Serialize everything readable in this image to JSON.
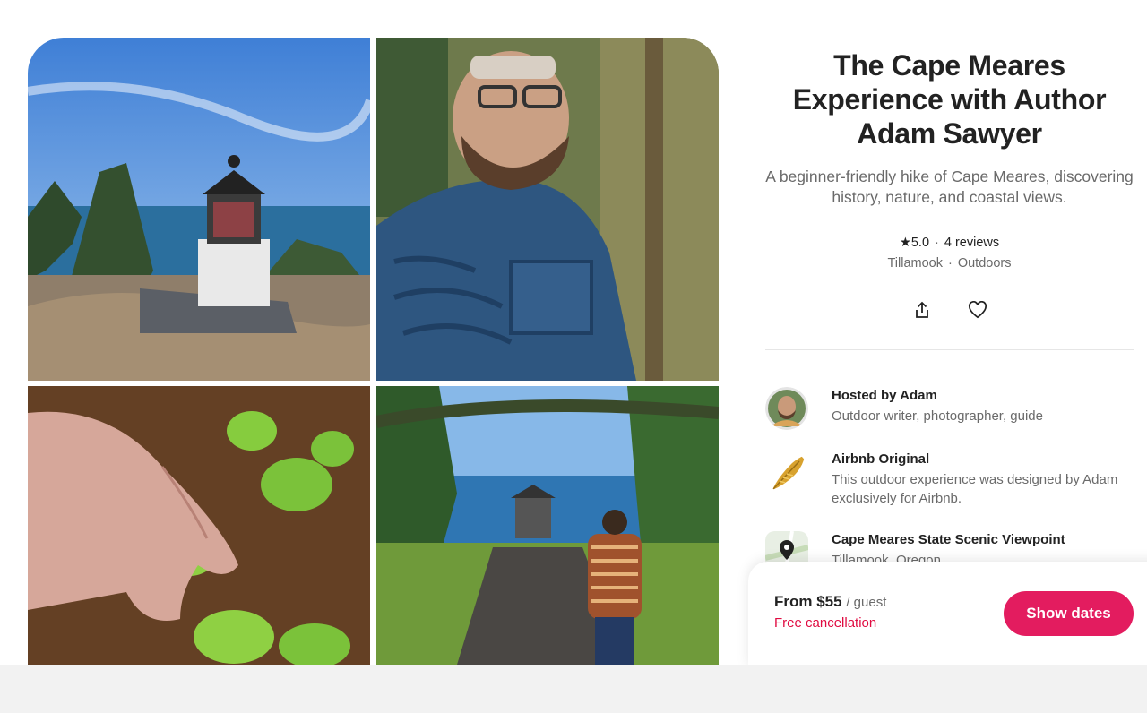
{
  "listing": {
    "title": "The Cape Meares Experience with Author Adam Sawyer",
    "subtitle": "A beginner-friendly hike of Cape Meares, discovering history, nature, and coastal views.",
    "rating": "5.0",
    "reviews": "4 reviews",
    "location": "Tillamook",
    "category": "Outdoors"
  },
  "gallery": {
    "photos": [
      "lighthouse-overlook",
      "host-portrait",
      "clover-hand",
      "trail-to-lighthouse"
    ]
  },
  "features": [
    {
      "title": "Hosted by Adam",
      "desc": "Outdoor writer, photographer, guide",
      "icon": "host-avatar"
    },
    {
      "title": "Airbnb Original",
      "desc": "This outdoor experience was designed by Adam exclusively for Airbnb.",
      "icon": "feather-icon"
    },
    {
      "title": "Cape Meares State Scenic Viewpoint",
      "desc": "Tillamook, Oregon",
      "icon": "map-pin-icon"
    }
  ],
  "booking": {
    "price": "From $55",
    "per": "/ guest",
    "cancellation": "Free cancellation",
    "cta": "Show dates"
  },
  "colors": {
    "brand": "#e31c5f",
    "cancel": "#e00b41",
    "muted": "#6a6a6a"
  }
}
